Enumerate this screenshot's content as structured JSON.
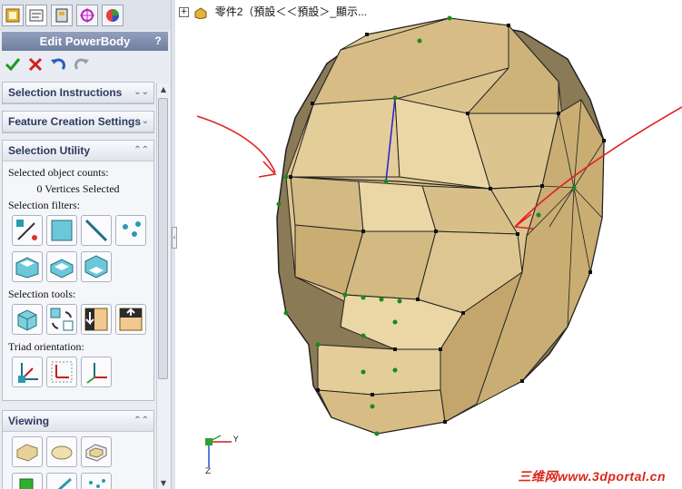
{
  "tabs": [
    {
      "icon": "feature-manager-icon"
    },
    {
      "icon": "property-manager-icon"
    },
    {
      "icon": "configuration-manager-icon"
    },
    {
      "icon": "dimxpert-icon"
    },
    {
      "icon": "display-manager-icon"
    }
  ],
  "panel": {
    "title": "Edit PowerBody",
    "help_label": "?",
    "actions": {
      "ok": "check-icon",
      "cancel": "x-icon",
      "undo": "undo-icon",
      "redo": "redo-icon"
    }
  },
  "groups": {
    "selection_instructions": {
      "title": "Selection Instructions",
      "collapsed": true
    },
    "feature_creation": {
      "title": "Feature Creation Settings",
      "collapsed": true
    },
    "selection_utility": {
      "title": "Selection Utility",
      "counts_label": "Selected object counts:",
      "counts_value": "0 Vertices Selected",
      "filters_label": "Selection filters:",
      "tools_label": "Selection tools:",
      "triad_label": "Triad orientation:"
    },
    "viewing": {
      "title": "Viewing"
    }
  },
  "viewport": {
    "tree_label": "零件2（預設＜＜預設＞_顯示...",
    "axis_y": "Y",
    "axis_z": "Z",
    "watermark": "三维网www.3dportal.cn"
  },
  "colors": {
    "accent": "#6f7f9f",
    "mesh_face": "#dcc48e",
    "mesh_dark": "#8a7a55",
    "annotation": "#e02020"
  }
}
